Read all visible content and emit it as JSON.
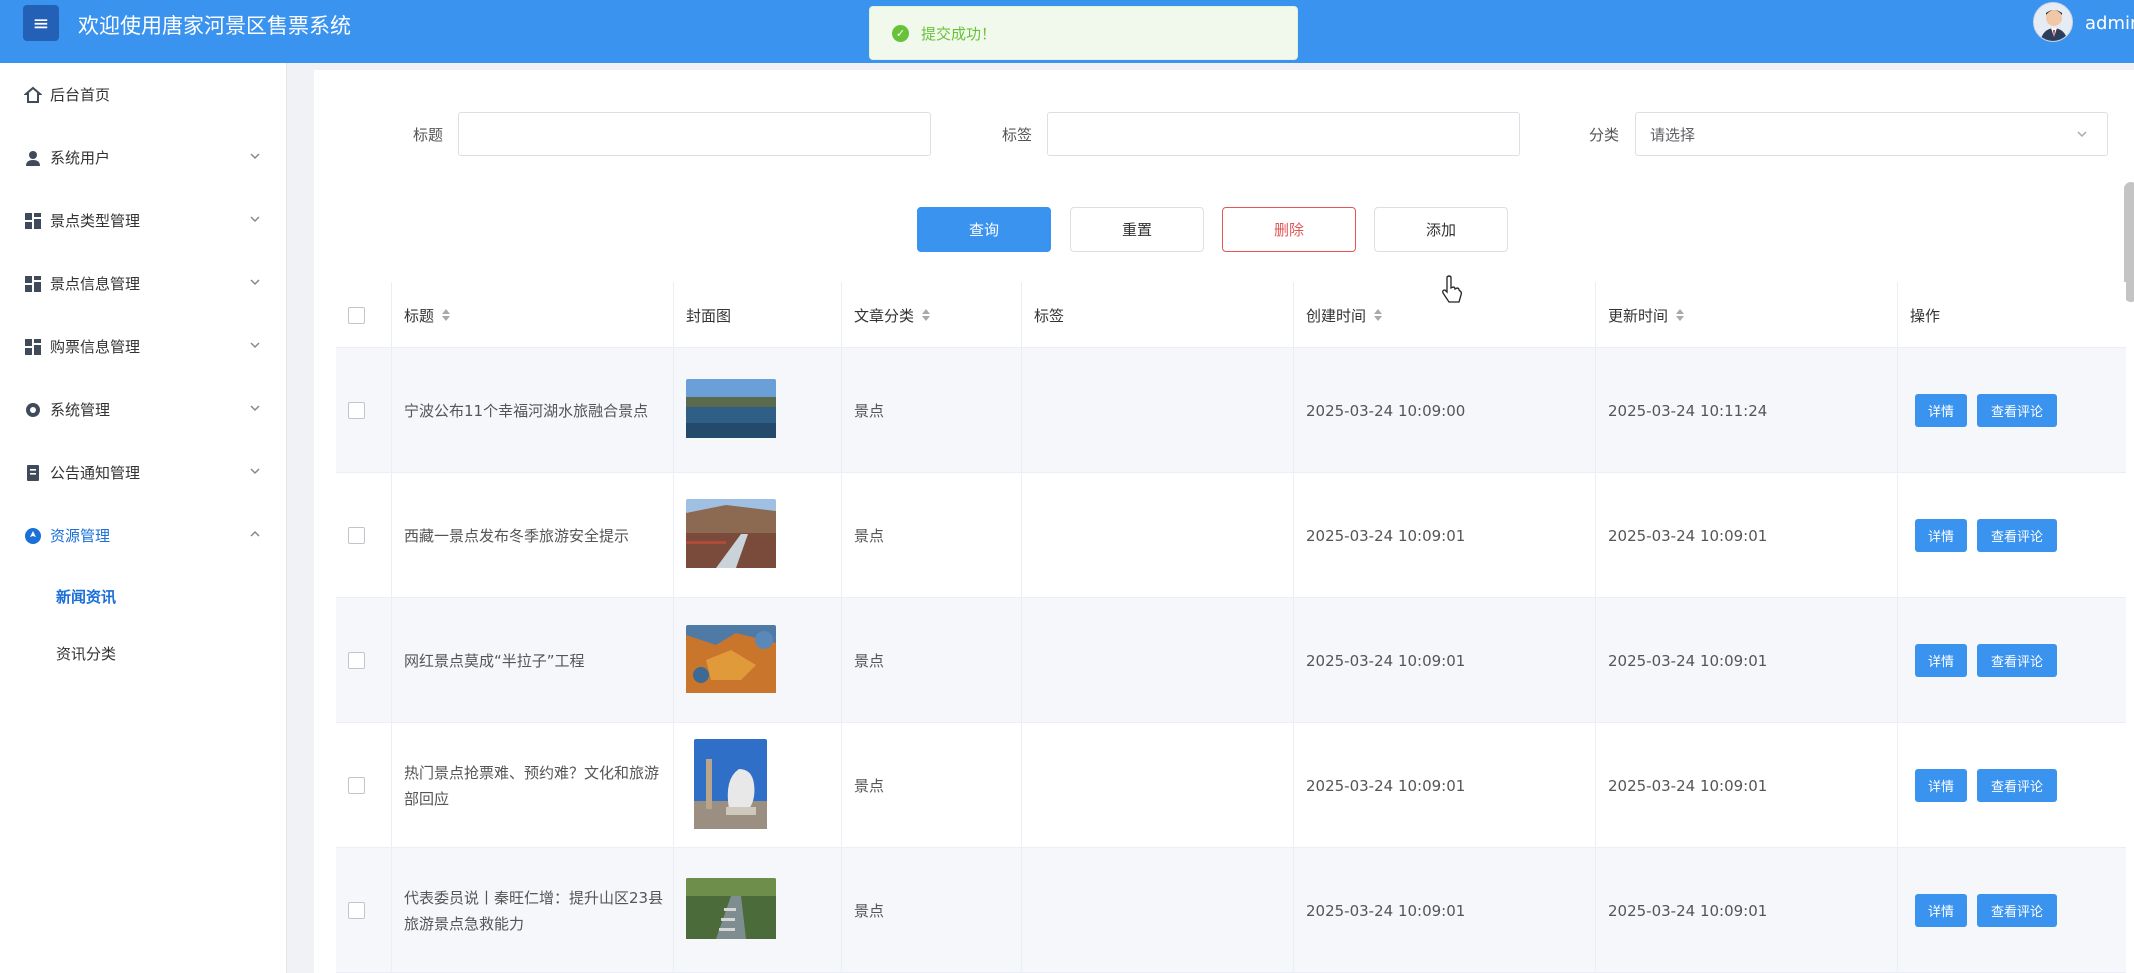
{
  "header": {
    "menu_icon": "hamburger-icon",
    "title": "欢迎使用唐家河景区售票系统",
    "username": "admin"
  },
  "toast": {
    "icon": "check-circle-icon",
    "text": "提交成功！"
  },
  "sidebar": {
    "items": [
      {
        "label": "后台首页",
        "icon": "home-icon"
      },
      {
        "label": "系统用户",
        "icon": "user-icon"
      },
      {
        "label": "景点类型管理",
        "icon": "grid-icon"
      },
      {
        "label": "景点信息管理",
        "icon": "grid-icon"
      },
      {
        "label": "购票信息管理",
        "icon": "grid-icon"
      },
      {
        "label": "系统管理",
        "icon": "gear-icon"
      },
      {
        "label": "公告通知管理",
        "icon": "document-icon"
      },
      {
        "label": "资源管理",
        "icon": "compass-icon"
      }
    ],
    "sub_items": [
      {
        "label": "新闻资讯",
        "active": true
      },
      {
        "label": "资讯分类",
        "active": false
      }
    ]
  },
  "filters": {
    "title_label": "标题",
    "tag_label": "标签",
    "category_label": "分类",
    "category_placeholder": "请选择"
  },
  "buttons": {
    "search": "查询",
    "reset": "重置",
    "delete": "删除",
    "add": "添加"
  },
  "table": {
    "headers": [
      "标题",
      "封面图",
      "文章分类",
      "标签",
      "创建时间",
      "更新时间",
      "操作"
    ],
    "detail_label": "详情",
    "comments_label": "查看评论",
    "rows": [
      {
        "title": "宁波公布11个幸福河湖水旅融合景点",
        "category": "景点",
        "tag": "",
        "created": "2025-03-24 10:09:00",
        "updated": "2025-03-24 10:11:24"
      },
      {
        "title": "西藏一景点发布冬季旅游安全提示",
        "category": "景点",
        "tag": "",
        "created": "2025-03-24 10:09:01",
        "updated": "2025-03-24 10:09:01"
      },
      {
        "title": "网红景点莫成“半拉子”工程",
        "category": "景点",
        "tag": "",
        "created": "2025-03-24 10:09:01",
        "updated": "2025-03-24 10:09:01"
      },
      {
        "title": "热门景点抢票难、预约难？文化和旅游部回应",
        "category": "景点",
        "tag": "",
        "created": "2025-03-24 10:09:01",
        "updated": "2025-03-24 10:09:01"
      },
      {
        "title": "代表委员说丨秦旺仁增：提升山区23县旅游景点急救能力",
        "category": "景点",
        "tag": "",
        "created": "2025-03-24 10:09:01",
        "updated": "2025-03-24 10:09:01"
      }
    ]
  }
}
